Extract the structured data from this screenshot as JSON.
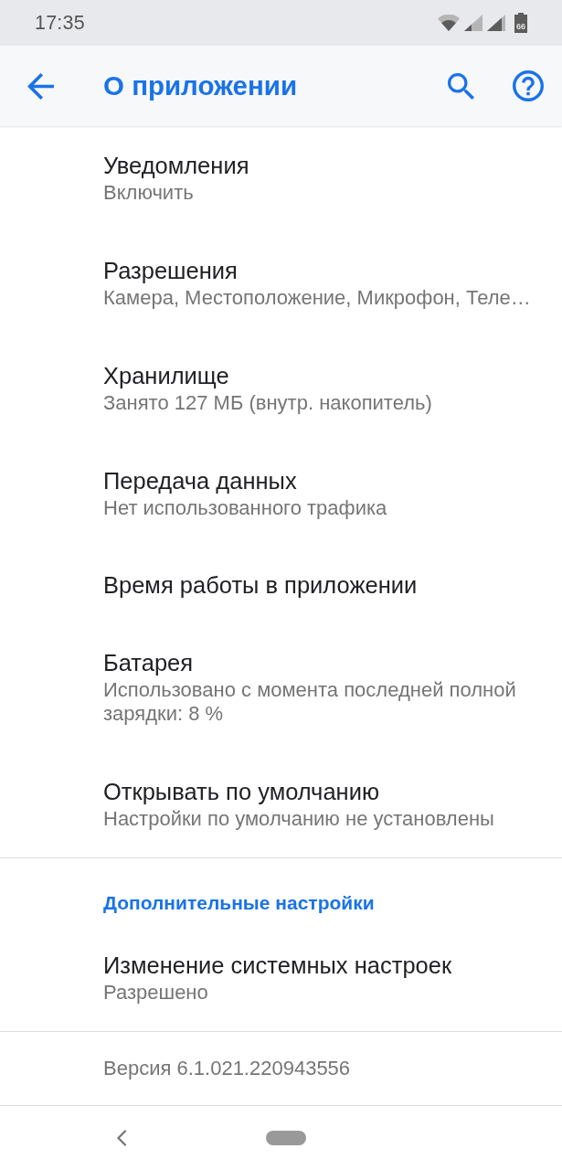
{
  "status_bar": {
    "time": "17:35",
    "battery_text": "66"
  },
  "app_bar": {
    "title": "О приложении"
  },
  "items": [
    {
      "title": "Уведомления",
      "subtitle": "Включить"
    },
    {
      "title": "Разрешения",
      "subtitle": "Камера, Местоположение, Микрофон, Теле…"
    },
    {
      "title": "Хранилище",
      "subtitle": "Занято 127 МБ (внутр. накопитель)"
    },
    {
      "title": "Передача данных",
      "subtitle": "Нет использованного трафика"
    },
    {
      "title": "Время работы в приложении"
    },
    {
      "title": "Батарея",
      "subtitle": "Использовано с момента последней полной зарядки: 8 %"
    },
    {
      "title": "Открывать по умолчанию",
      "subtitle": "Настройки по умолчанию не установлены"
    }
  ],
  "section": {
    "header": "Дополнительные настройки",
    "items": [
      {
        "title": "Изменение системных настроек",
        "subtitle": "Разрешено"
      }
    ]
  },
  "version": "Версия 6.1.021.220943556"
}
